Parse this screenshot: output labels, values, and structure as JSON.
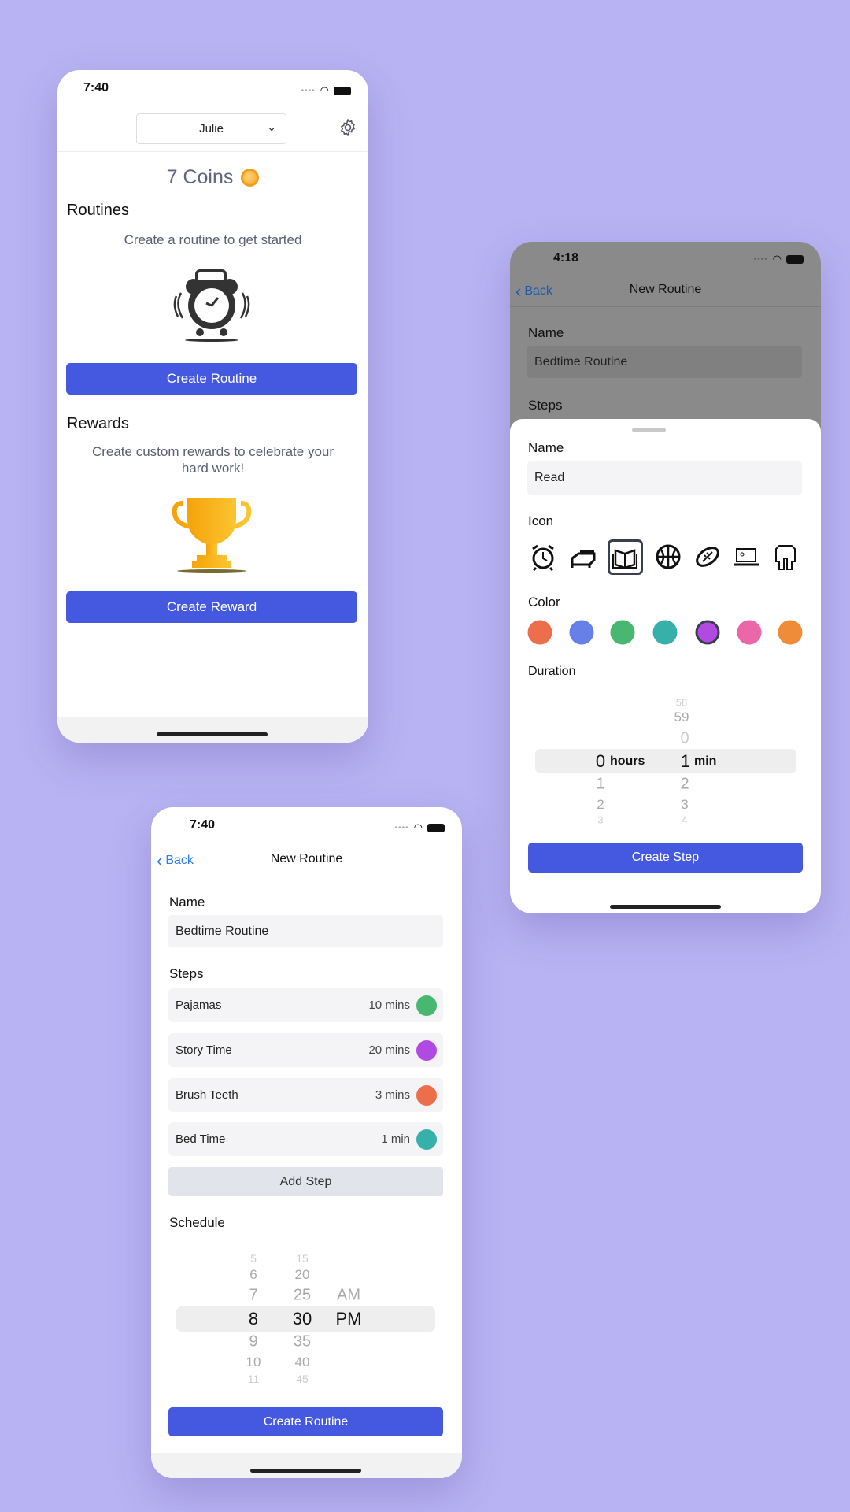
{
  "home": {
    "time": "7:40",
    "profile_select": "Julie",
    "coins": "7 Coins",
    "routines_heading": "Routines",
    "routines_empty": "Create a routine to get started",
    "create_routine": "Create Routine",
    "rewards_heading": "Rewards",
    "rewards_empty_1": "Create custom rewards to celebrate your",
    "rewards_empty_2": "hard work!",
    "create_reward": "Create Reward"
  },
  "new_routine": {
    "time": "7:40",
    "back": "Back",
    "title": "New Routine",
    "name_label": "Name",
    "name_value": "Bedtime Routine",
    "steps_label": "Steps",
    "steps": [
      {
        "name": "Pajamas",
        "duration": "10 mins",
        "color": "#48b871"
      },
      {
        "name": "Story Time",
        "duration": "20 mins",
        "color": "#b04ae0"
      },
      {
        "name": "Brush Teeth",
        "duration": "3 mins",
        "color": "#ec6e4a"
      },
      {
        "name": "Bed Time",
        "duration": "1 min",
        "color": "#36b1aa"
      }
    ],
    "add_step": "Add Step",
    "schedule_label": "Schedule",
    "schedule_picker": {
      "hours": [
        "5",
        "6",
        "7",
        "8",
        "9",
        "10",
        "11"
      ],
      "minutes": [
        "15",
        "20",
        "25",
        "30",
        "35",
        "40",
        "45"
      ],
      "period": [
        "AM",
        "PM"
      ],
      "selected": {
        "hour": "8",
        "minute": "30",
        "period": "PM"
      }
    },
    "create_routine": "Create Routine"
  },
  "new_step_sheet": {
    "time": "4:18",
    "back": "Back",
    "title": "New Routine",
    "bg_name_label": "Name",
    "bg_name_value": "Bedtime Routine",
    "bg_steps_label": "Steps",
    "name_label": "Name",
    "name_value": "Read",
    "icon_label": "Icon",
    "icons": [
      "alarm-clock-icon",
      "bed-icon",
      "book-icon",
      "basketball-icon",
      "football-icon",
      "laptop-icon",
      "pajamas-icon"
    ],
    "selected_icon": "book-icon",
    "color_label": "Color",
    "colors": [
      "#ec6e4a",
      "#6680e8",
      "#48b871",
      "#36b1aa",
      "#b04ae0",
      "#ec67a8",
      "#ee8c3a"
    ],
    "selected_color": "#b04ae0",
    "duration_label": "Duration",
    "duration_picker": {
      "hours": [
        "0",
        "1",
        "2",
        "3"
      ],
      "minutes": [
        "58",
        "59",
        "0",
        "1",
        "2",
        "3",
        "4"
      ],
      "hours_unit": "hours",
      "minutes_unit": "min",
      "selected": {
        "hours": "0",
        "minutes": "1"
      }
    },
    "create_step": "Create Step"
  },
  "colors": {
    "accent": "#4459e0",
    "background": "#b8b3f2"
  }
}
